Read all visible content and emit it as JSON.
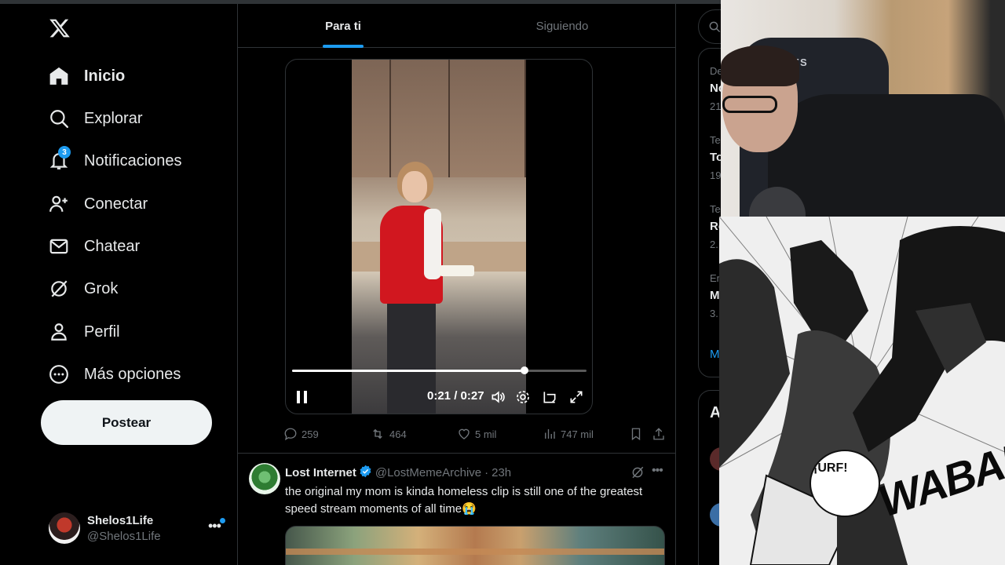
{
  "nav": {
    "items": [
      {
        "label": "Inicio",
        "icon": "home-icon",
        "active": true
      },
      {
        "label": "Explorar",
        "icon": "search-icon"
      },
      {
        "label": "Notificaciones",
        "icon": "bell-icon",
        "badge": "3"
      },
      {
        "label": "Conectar",
        "icon": "person-add-icon"
      },
      {
        "label": "Chatear",
        "icon": "mail-icon"
      },
      {
        "label": "Grok",
        "icon": "grok-icon"
      },
      {
        "label": "Perfil",
        "icon": "person-icon"
      },
      {
        "label": "Más opciones",
        "icon": "more-circle-icon"
      }
    ],
    "post_label": "Postear",
    "account": {
      "name": "Shelos1Life",
      "handle": "@Shelos1Life"
    }
  },
  "tabs": [
    {
      "label": "Para ti",
      "active": true
    },
    {
      "label": "Siguiendo",
      "active": false
    }
  ],
  "video": {
    "time": "0:21 / 0:27",
    "progress": 0.79,
    "controls": [
      "pause-icon",
      "volume-icon",
      "settings-icon",
      "pip-icon",
      "fullscreen-icon"
    ]
  },
  "actions": {
    "replies": "259",
    "reposts": "464",
    "likes": "5 mil",
    "views": "747 mil"
  },
  "tweet": {
    "name": "Lost Internet",
    "verified": true,
    "handle": "@LostMemeArchive",
    "separator": "·",
    "time": "23h",
    "text": "the original my mom is kinda homeless clip is still one of the greatest speed stream moments of all time😭"
  },
  "right_column": {
    "trend_fragments": [
      "De",
      "Nc",
      "21",
      "Te",
      "To",
      "19",
      "Te",
      "Re",
      "2.",
      "En",
      "M",
      "3."
    ],
    "show_more": "M",
    "panel_head": "A"
  },
  "webcam": {
    "chair_text": "UPPLIES"
  },
  "manga": {
    "speech": "¡URF!",
    "sfx": "WABAM"
  },
  "colors": {
    "background": "#000000",
    "accent": "#1d9bf0",
    "text": "#e7e9ea",
    "muted": "#71767b",
    "border": "#2f3336",
    "post_button": "#eff3f4"
  }
}
